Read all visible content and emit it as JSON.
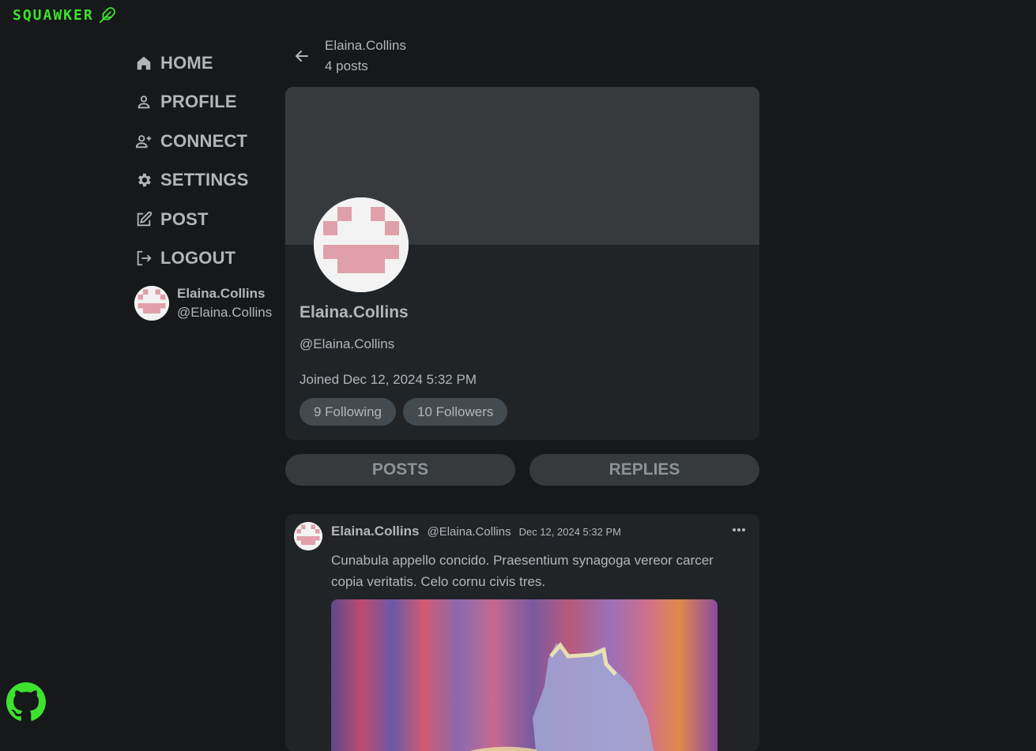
{
  "brand": {
    "name": "SQUAWKER",
    "icon": "feather-icon",
    "color": "#3ee22e"
  },
  "nav": {
    "items": [
      {
        "label": "HOME",
        "icon": "home-icon"
      },
      {
        "label": "PROFILE",
        "icon": "user-icon"
      },
      {
        "label": "CONNECT",
        "icon": "user-plus-icon"
      },
      {
        "label": "SETTINGS",
        "icon": "gear-icon"
      },
      {
        "label": "POST",
        "icon": "edit-icon"
      },
      {
        "label": "LOGOUT",
        "icon": "logout-icon"
      }
    ]
  },
  "current_user": {
    "name": "Elaina.Collins",
    "handle": "@Elaina.Collins"
  },
  "header": {
    "name": "Elaina.Collins",
    "posts_count": "4 posts"
  },
  "profile": {
    "name": "Elaina.Collins",
    "handle": "@Elaina.Collins",
    "joined": "Joined Dec 12, 2024 5:32 PM",
    "following": "9 Following",
    "followers": "10 Followers"
  },
  "tabs": [
    {
      "label": "POSTS"
    },
    {
      "label": "REPLIES"
    }
  ],
  "posts": [
    {
      "author": "Elaina.Collins",
      "handle": "@Elaina.Collins",
      "date": "Dec 12, 2024 5:32 PM",
      "text": "Cunabula appello concido. Praesentium synagoga vereor carcer copia veritatis. Celo cornu civis tres."
    }
  ],
  "footer": {
    "github_icon": "github-icon",
    "color": "#3ee22e"
  },
  "colors": {
    "background": "#16181a",
    "card": "#202427",
    "banner": "#363a3d",
    "avatar_pink": "#e0a0aa"
  }
}
